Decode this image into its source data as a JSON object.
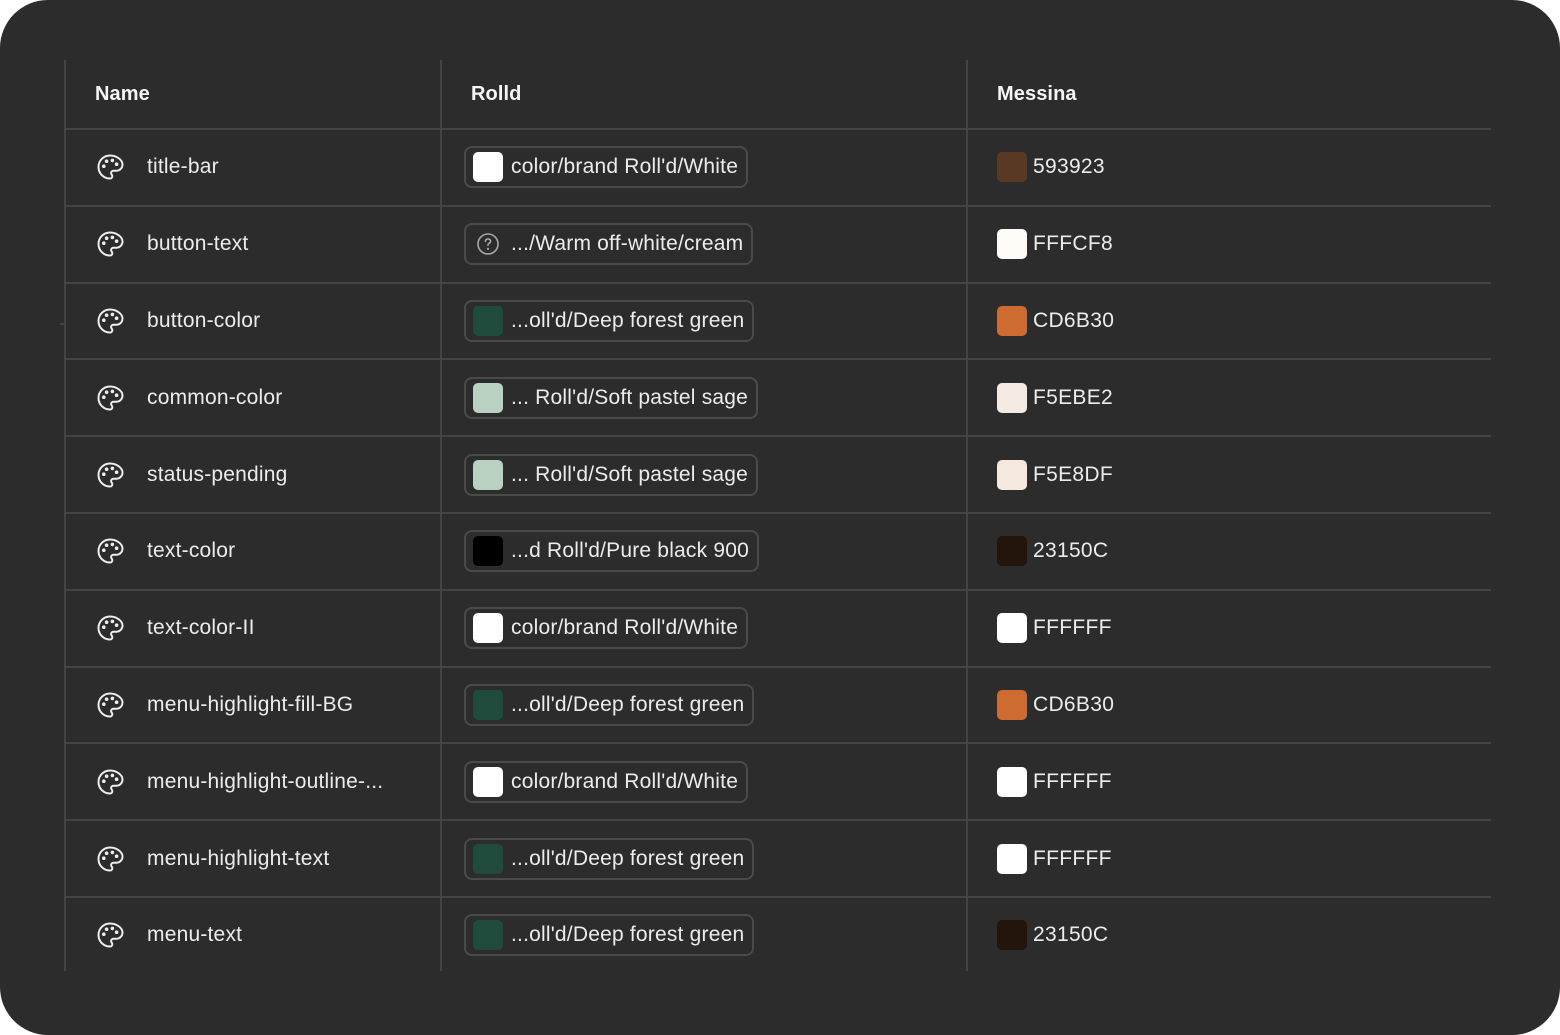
{
  "table": {
    "headers": {
      "name": "Name",
      "rolld": "Rolld",
      "messina": "Messina"
    },
    "rows": [
      {
        "name": "title-bar",
        "rolld_label": "color/brand Roll'd/White",
        "rolld_swatch": "#FFFFFF",
        "rolld_icon": "",
        "messina_hex": "593923",
        "messina_color": "#593923"
      },
      {
        "name": "button-text",
        "rolld_label": ".../Warm off-white/cream",
        "rolld_swatch": "",
        "rolld_icon": "question-circle-icon",
        "messina_hex": "FFFCF8",
        "messina_color": "#FFFCF8"
      },
      {
        "name": "button-color",
        "rolld_label": "...oll'd/Deep forest green",
        "rolld_swatch": "#1F4A3C",
        "rolld_icon": "",
        "messina_hex": "CD6B30",
        "messina_color": "#CD6B30"
      },
      {
        "name": "common-color",
        "rolld_label": "... Roll'd/Soft pastel sage",
        "rolld_swatch": "#B9D1C1",
        "rolld_icon": "",
        "messina_hex": "F5EBE2",
        "messina_color": "#F5EBE2"
      },
      {
        "name": "status-pending",
        "rolld_label": "... Roll'd/Soft pastel sage",
        "rolld_swatch": "#B9D1C1",
        "rolld_icon": "",
        "messina_hex": "F5E8DF",
        "messina_color": "#F5E8DF"
      },
      {
        "name": "text-color",
        "rolld_label": "...d Roll'd/Pure black 900",
        "rolld_swatch": "#000000",
        "rolld_icon": "",
        "messina_hex": "23150C",
        "messina_color": "#23150C"
      },
      {
        "name": "text-color-II",
        "rolld_label": "color/brand Roll'd/White",
        "rolld_swatch": "#FFFFFF",
        "rolld_icon": "",
        "messina_hex": "FFFFFF",
        "messina_color": "#FFFFFF"
      },
      {
        "name": "menu-highlight-fill-BG",
        "rolld_label": "...oll'd/Deep forest green",
        "rolld_swatch": "#1F4A3C",
        "rolld_icon": "",
        "messina_hex": "CD6B30",
        "messina_color": "#CD6B30"
      },
      {
        "name": "menu-highlight-outline-...",
        "rolld_label": "color/brand Roll'd/White",
        "rolld_swatch": "#FFFFFF",
        "rolld_icon": "",
        "messina_hex": "FFFFFF",
        "messina_color": "#FFFFFF"
      },
      {
        "name": "menu-highlight-text",
        "rolld_label": "...oll'd/Deep forest green",
        "rolld_swatch": "#1F4A3C",
        "rolld_icon": "",
        "messina_hex": "FFFFFF",
        "messina_color": "#FFFFFF"
      },
      {
        "name": "menu-text",
        "rolld_label": "...oll'd/Deep forest green",
        "rolld_swatch": "#1F4A3C",
        "rolld_icon": "",
        "messina_hex": "23150C",
        "messina_color": "#23150C"
      }
    ]
  },
  "icons": {
    "row_icon": "palette-icon"
  }
}
